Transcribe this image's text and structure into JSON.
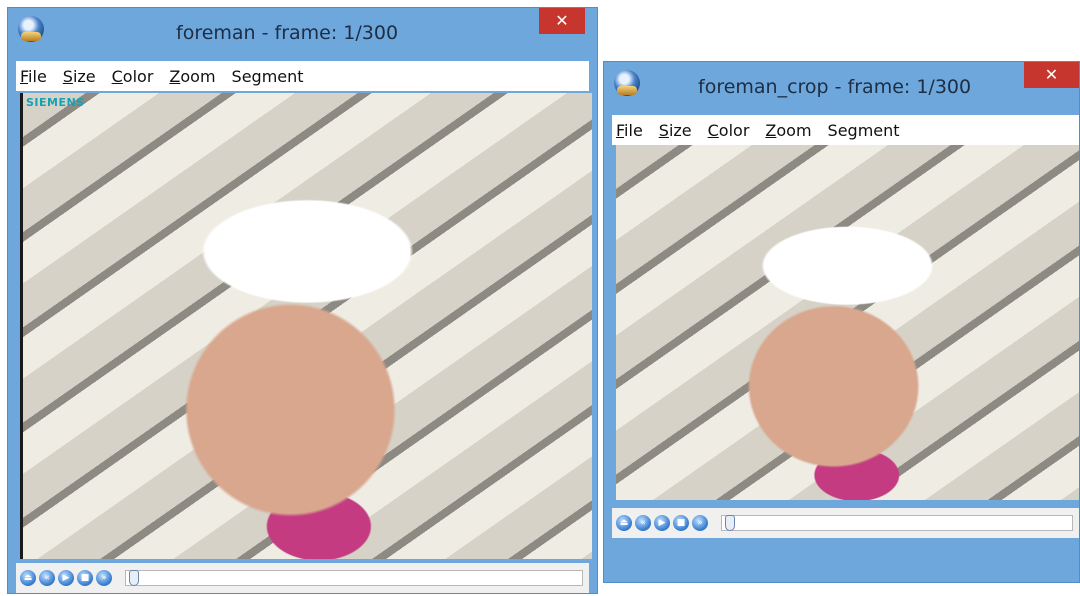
{
  "windows": [
    {
      "title": "foreman - frame: 1/300",
      "close_glyph": "✕",
      "menu": [
        {
          "label": "File",
          "accel": "F",
          "rest": "ile"
        },
        {
          "label": "Size",
          "accel": "S",
          "rest": "ize"
        },
        {
          "label": "Color",
          "accel": "C",
          "rest": "olor"
        },
        {
          "label": "Zoom",
          "accel": "Z",
          "rest": "oom"
        },
        {
          "label": "Segment",
          "accel": "",
          "rest": "Segment"
        }
      ],
      "overlay_text": "SIEMENS",
      "controls": [
        "eject-icon",
        "rewind-icon",
        "play-icon",
        "stop-icon",
        "fast-forward-icon"
      ],
      "position_fraction": 0.0
    },
    {
      "title": "foreman_crop - frame: 1/300",
      "close_glyph": "✕",
      "menu": [
        {
          "label": "File",
          "accel": "F",
          "rest": "ile"
        },
        {
          "label": "Size",
          "accel": "S",
          "rest": "ize"
        },
        {
          "label": "Color",
          "accel": "C",
          "rest": "olor"
        },
        {
          "label": "Zoom",
          "accel": "Z",
          "rest": "oom"
        },
        {
          "label": "Segment",
          "accel": "",
          "rest": "Segment"
        }
      ],
      "controls": [
        "eject-icon",
        "rewind-icon",
        "play-icon",
        "stop-icon",
        "fast-forward-icon"
      ],
      "position_fraction": 0.0
    }
  ],
  "control_glyphs": {
    "eject-icon": "⏏",
    "rewind-icon": "«",
    "play-icon": "▶",
    "stop-icon": "■",
    "fast-forward-icon": "»"
  },
  "colors": {
    "window_frame": "#6ea7dc",
    "close_button": "#c7362e",
    "siemens_logo": "#14a2b5"
  }
}
